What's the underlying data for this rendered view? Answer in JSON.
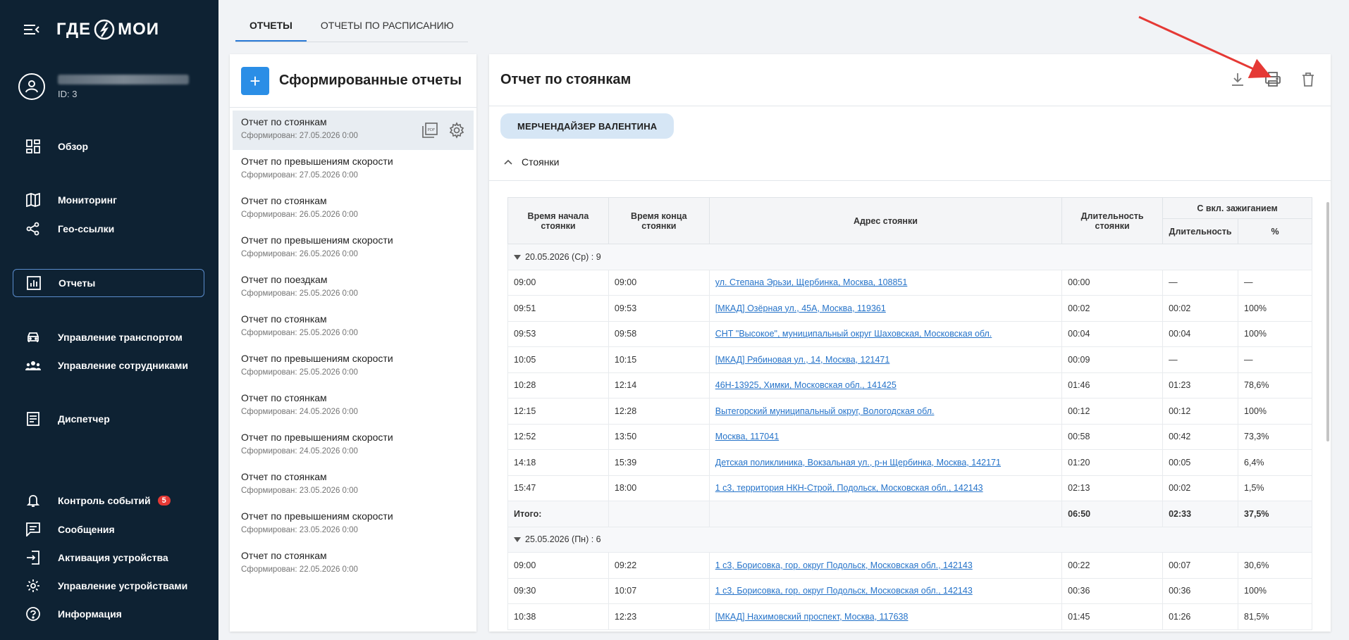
{
  "logo": {
    "left": "ГДЕ",
    "right": "МОИ"
  },
  "user": {
    "id": "ID: 3"
  },
  "nav": {
    "overview": "Обзор",
    "monitoring": "Мониторинг",
    "geolinks": "Гео-ссылки",
    "reports": "Отчеты",
    "transport": "Управление транспортом",
    "employees": "Управление сотрудниками",
    "dispatcher": "Диспетчер",
    "events": "Контроль событий",
    "events_badge": "5",
    "messages": "Сообщения",
    "activation": "Активация устройства",
    "devices": "Управление устройствами",
    "info": "Информация"
  },
  "tabs": [
    "ОТЧЕТЫ",
    "ОТЧЕТЫ ПО РАСПИСАНИЮ"
  ],
  "left_panel": {
    "add": "+",
    "title": "Сформированные отчеты",
    "reports": [
      {
        "name": "Отчет по стоянкам",
        "date": "Сформирован: 27.05.2026 0:00"
      },
      {
        "name": "Отчет по превышениям скорости",
        "date": "Сформирован: 27.05.2026 0:00"
      },
      {
        "name": "Отчет по стоянкам",
        "date": "Сформирован: 26.05.2026 0:00"
      },
      {
        "name": "Отчет по превышениям скорости",
        "date": "Сформирован: 26.05.2026 0:00"
      },
      {
        "name": "Отчет по поездкам",
        "date": "Сформирован: 25.05.2026 0:00"
      },
      {
        "name": "Отчет по стоянкам",
        "date": "Сформирован: 25.05.2026 0:00"
      },
      {
        "name": "Отчет по превышениям скорости",
        "date": "Сформирован: 25.05.2026 0:00"
      },
      {
        "name": "Отчет по стоянкам",
        "date": "Сформирован: 24.05.2026 0:00"
      },
      {
        "name": "Отчет по превышениям скорости",
        "date": "Сформирован: 24.05.2026 0:00"
      },
      {
        "name": "Отчет по стоянкам",
        "date": "Сформирован: 23.05.2026 0:00"
      },
      {
        "name": "Отчет по превышениям скорости",
        "date": "Сформирован: 23.05.2026 0:00"
      },
      {
        "name": "Отчет по стоянкам",
        "date": "Сформирован: 22.05.2026 0:00"
      }
    ]
  },
  "right_panel": {
    "title": "Отчет по стоянкам",
    "chip": "МЕРЧЕНДАЙЗЕР ВАЛЕНТИНА",
    "section": "Стоянки",
    "headers": {
      "start": "Время начала стоянки",
      "end": "Время конца стоянки",
      "address": "Адрес стоянки",
      "duration": "Длительность стоянки",
      "ignition": "С вкл. зажиганием",
      "ign_duration": "Длительность",
      "ign_percent": "%"
    },
    "group1": {
      "label": "20.05.2026 (Ср) : 9",
      "rows": [
        [
          "09:00",
          "09:00",
          "ул. Степана Эрьзи, Щербинка, Москва, 108851",
          "00:00",
          "—",
          "—"
        ],
        [
          "09:51",
          "09:53",
          "[МКАД] Озёрная ул., 45А, Москва, 119361",
          "00:02",
          "00:02",
          "100%"
        ],
        [
          "09:53",
          "09:58",
          "СНТ \"Высокое\", муниципальный округ Шаховская, Московская обл.",
          "00:04",
          "00:04",
          "100%"
        ],
        [
          "10:05",
          "10:15",
          "[МКАД] Рябиновая ул., 14, Москва, 121471",
          "00:09",
          "—",
          "—"
        ],
        [
          "10:28",
          "12:14",
          "46Н-13925, Химки, Московская обл., 141425",
          "01:46",
          "01:23",
          "78,6%"
        ],
        [
          "12:15",
          "12:28",
          "Вытегорский муниципальный округ, Вологодская обл.",
          "00:12",
          "00:12",
          "100%"
        ],
        [
          "12:52",
          "13:50",
          "Москва, 117041",
          "00:58",
          "00:42",
          "73,3%"
        ],
        [
          "14:18",
          "15:39",
          "Детская поликлиника, Вокзальная ул., р-н Щербинка, Москва, 142171",
          "01:20",
          "00:05",
          "6,4%"
        ],
        [
          "15:47",
          "18:00",
          "1 с3, территория НКН-Строй, Подольск, Московская обл., 142143",
          "02:13",
          "00:02",
          "1,5%"
        ]
      ],
      "total": [
        "Итого:",
        "06:50",
        "02:33",
        "37,5%"
      ]
    },
    "group2": {
      "label": "25.05.2026 (Пн) : 6",
      "rows": [
        [
          "09:00",
          "09:22",
          "1 с3, Борисовка, гор. округ Подольск, Московская обл., 142143",
          "00:22",
          "00:07",
          "30,6%"
        ],
        [
          "09:30",
          "10:07",
          "1 с3, Борисовка, гор. округ Подольск, Московская обл., 142143",
          "00:36",
          "00:36",
          "100%"
        ],
        [
          "10:38",
          "12:23",
          "[МКАД] Нахимовский проспект, Москва, 117638",
          "01:45",
          "01:26",
          "81,5%"
        ]
      ]
    }
  }
}
